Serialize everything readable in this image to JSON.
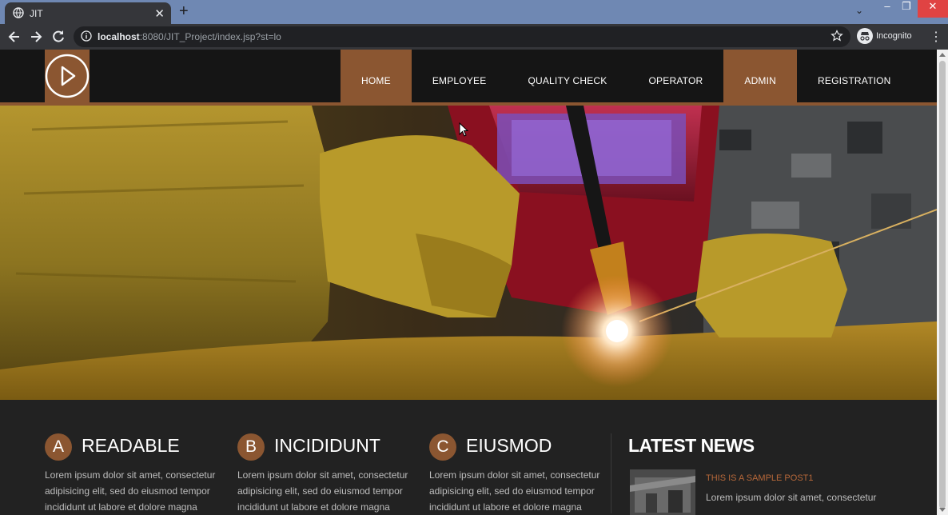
{
  "browser": {
    "tab_title": "JIT",
    "url_host": "localhost",
    "url_rest": ":8080/JIT_Project/index.jsp?st=lo",
    "profile_label": "Incognito"
  },
  "site": {
    "nav": [
      {
        "label": "HOME",
        "active": true
      },
      {
        "label": "EMPLOYEE",
        "active": false
      },
      {
        "label": "QUALITY CHECK",
        "active": false
      },
      {
        "label": "OPERATOR",
        "active": false
      },
      {
        "label": "ADMIN",
        "active": true
      },
      {
        "label": "REGISTRATION",
        "active": false
      }
    ],
    "features": [
      {
        "letter": "A",
        "title": "READABLE",
        "text": "Lorem ipsum dolor sit amet, consectetur adipisicing elit, sed do eiusmod tempor incididunt ut labore et dolore magna"
      },
      {
        "letter": "B",
        "title": "INCIDIDUNT",
        "text": "Lorem ipsum dolor sit amet, consectetur adipisicing elit, sed do eiusmod tempor incididunt ut labore et dolore magna"
      },
      {
        "letter": "C",
        "title": "EIUSMOD",
        "text": "Lorem ipsum dolor sit amet, consectetur adipisicing elit, sed do eiusmod tempor incididunt ut labore et dolore magna"
      }
    ],
    "news": {
      "heading": "LATEST NEWS",
      "post_title": "THIS IS A SAMPLE POST1",
      "post_excerpt": "Lorem ipsum dolor sit amet, consectetur"
    }
  },
  "colors": {
    "accent": "#8b5631",
    "header_bg": "#151515",
    "body_bg": "#222222"
  }
}
